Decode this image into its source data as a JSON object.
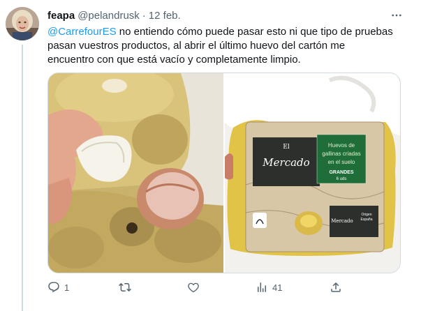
{
  "author": {
    "name": "feapa",
    "handle": "@pelandrusk",
    "separator": "·",
    "date": "12 feb."
  },
  "tweet": {
    "mention": "@CarrefourES",
    "line1_rest": " no entiendo cómo puede pasar esto ni que tipo de pruebas",
    "line2": "pasan vuestros productos, al abrir el último huevo del cartón me",
    "line3": "encuentro con que está vacío y completamente limpio."
  },
  "package": {
    "brand_top": "El",
    "brand": "Mercado",
    "label_line1": "Huevos de",
    "label_line2": "gallinas criadas",
    "label_line3": "en el suelo",
    "size": "GRANDES",
    "count": "6 uds",
    "origin_line1": "Origen",
    "origin_line2": "España",
    "small_brand": "Mercado"
  },
  "actions": {
    "replies": "1",
    "retweets": "",
    "likes": "",
    "views": "41"
  },
  "icons": {
    "more": "more-icon",
    "reply": "reply-icon",
    "retweet": "retweet-icon",
    "like": "like-icon",
    "views": "views-icon",
    "share": "share-icon"
  },
  "colors": {
    "link": "#1d9bf0",
    "muted": "#536471",
    "text": "#0f1419"
  }
}
